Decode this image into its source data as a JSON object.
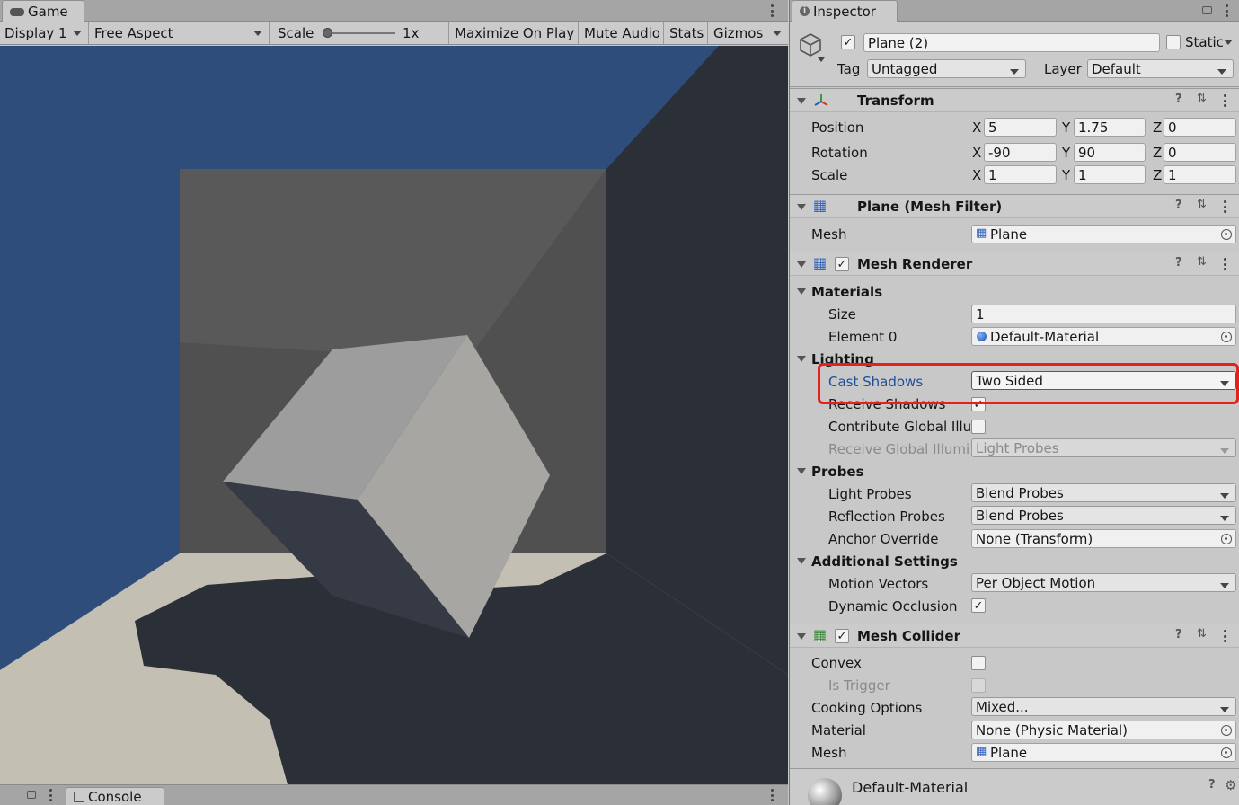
{
  "game": {
    "tab_label": "Game",
    "display": "Display 1",
    "aspect": "Free Aspect",
    "scale_label": "Scale",
    "scale_value": "1x",
    "maximize": "Maximize On Play",
    "mute": "Mute Audio",
    "stats": "Stats",
    "gizmos": "Gizmos"
  },
  "console": {
    "tab_label": "Console"
  },
  "inspector": {
    "tab_label": "Inspector",
    "object_name": "Plane (2)",
    "static_label": "Static",
    "tag_label": "Tag",
    "tag_value": "Untagged",
    "layer_label": "Layer",
    "layer_value": "Default",
    "transform": {
      "title": "Transform",
      "position_label": "Position",
      "rotation_label": "Rotation",
      "scale_label": "Scale",
      "axis_x": "X",
      "axis_y": "Y",
      "axis_z": "Z",
      "position": {
        "x": "5",
        "y": "1.75",
        "z": "0"
      },
      "rotation": {
        "x": "-90",
        "y": "90",
        "z": "0"
      },
      "scale": {
        "x": "1",
        "y": "1",
        "z": "1"
      }
    },
    "mesh_filter": {
      "title": "Plane (Mesh Filter)",
      "mesh_label": "Mesh",
      "mesh_value": "Plane"
    },
    "mesh_renderer": {
      "title": "Mesh Renderer",
      "materials_label": "Materials",
      "size_label": "Size",
      "size_value": "1",
      "element0_label": "Element 0",
      "element0_value": "Default-Material",
      "lighting_label": "Lighting",
      "cast_shadows_label": "Cast Shadows",
      "cast_shadows_value": "Two Sided",
      "receive_shadows_label": "Receive Shadows",
      "contribute_gi_label": "Contribute Global Illun",
      "receive_gi_label": "Receive Global Illumir",
      "receive_gi_value": "Light Probes",
      "probes_label": "Probes",
      "light_probes_label": "Light Probes",
      "light_probes_value": "Blend Probes",
      "reflection_probes_label": "Reflection Probes",
      "reflection_probes_value": "Blend Probes",
      "anchor_override_label": "Anchor Override",
      "anchor_override_value": "None (Transform)",
      "additional_label": "Additional Settings",
      "motion_vectors_label": "Motion Vectors",
      "motion_vectors_value": "Per Object Motion",
      "dynamic_occlusion_label": "Dynamic Occlusion"
    },
    "mesh_collider": {
      "title": "Mesh Collider",
      "convex_label": "Convex",
      "is_trigger_label": "Is Trigger",
      "cooking_label": "Cooking Options",
      "cooking_value": "Mixed...",
      "material_label": "Material",
      "material_value": "None (Physic Material)",
      "mesh_label": "Mesh",
      "mesh_value": "Plane"
    },
    "material_preview": {
      "name": "Default-Material"
    }
  },
  "colors": {
    "highlight": "#e8201a",
    "link_blue": "#1d4e9a",
    "sky": "#2f4d7a"
  }
}
